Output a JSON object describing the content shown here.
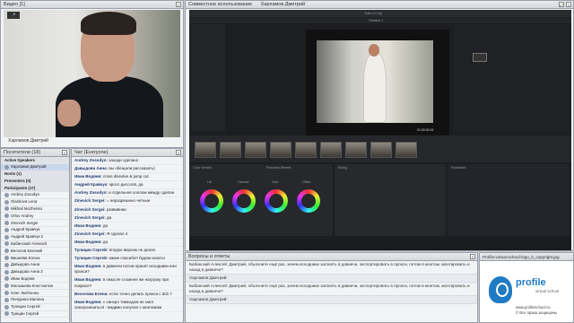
{
  "video": {
    "title": "Видео",
    "count": "[1]",
    "presenter": "Харламов Дмитрий"
  },
  "share": {
    "title": "Совместное использование",
    "presenter_tab": "Харламов Дмитрий",
    "app": {
      "page_title": "Timeline 1",
      "clip_name": "Kate 01 Clip",
      "timecode": "01:00:00:01",
      "panels": [
        "Color Wheels",
        "Primaries Wheels",
        "Sizing",
        "Keyframes"
      ],
      "wheels": [
        "Lift",
        "Gamma",
        "Gain",
        "Offset"
      ]
    }
  },
  "participants": {
    "title": "Посетители",
    "count": "(18)",
    "rows": [
      {
        "label": "Active Speakers",
        "type": "group"
      },
      {
        "label": "Харламов Дмитрий",
        "type": "sel"
      },
      {
        "label": "Hosts (1)",
        "type": "group"
      },
      {
        "label": "Presenters (0)",
        "type": "group"
      },
      {
        "label": "Participants (17)",
        "type": "group"
      },
      {
        "label": "Andrey Zosodyn",
        "type": "p"
      },
      {
        "label": "Glazkova Lena",
        "type": "p"
      },
      {
        "label": "Mikhail Mozhenko",
        "type": "p"
      },
      {
        "label": "Orlov Andrey",
        "type": "p"
      },
      {
        "label": "Zinevich Sergei",
        "type": "p"
      },
      {
        "label": "Андрей Кравчук",
        "type": "p"
      },
      {
        "label": "Андрей Кравчук 2",
        "type": "p"
      },
      {
        "label": "Бабинский Алексей",
        "type": "p"
      },
      {
        "label": "Веселов Евгений",
        "type": "p"
      },
      {
        "label": "Вишнёва Елена",
        "type": "p"
      },
      {
        "label": "Давыдова Анна",
        "type": "p"
      },
      {
        "label": "Давыдова Анна 2",
        "type": "p"
      },
      {
        "label": "Иван Водяев",
        "type": "p"
      },
      {
        "label": "Малышева Константин",
        "type": "p"
      },
      {
        "label": "Олег Любченко",
        "type": "p"
      },
      {
        "label": "Пичурина Милена",
        "type": "p"
      },
      {
        "label": "Тулицин Сергей",
        "type": "p"
      },
      {
        "label": "Туищин Сергей",
        "type": "p"
      }
    ]
  },
  "chat": {
    "title": "Чат",
    "sub": "(Everyone)",
    "messages": [
      {
        "from": "Andrey Zosodyn:",
        "text": "заходи сделано"
      },
      {
        "from": "Давыдова Анна:",
        "text": "вы обещали рассказать)"
      },
      {
        "from": "Иван Водяев:",
        "text": "cross dissolve & jump cut"
      },
      {
        "from": "Андрей Кравчук:",
        "text": "кросс-диссолв, да"
      },
      {
        "from": "Andrey Zosodyn:",
        "text": "и отдельное хоплом между сделан"
      },
      {
        "from": "Zinevich Sergei:",
        "text": "= неразрешено четные"
      },
      {
        "from": "Zinevich Sergei:",
        "text": "развивнан"
      },
      {
        "from": "Zinevich Sergei:",
        "text": "да"
      },
      {
        "from": "Иван Водяев:",
        "text": "да"
      },
      {
        "from": "Zinevich Sergei:",
        "text": "Я сделал 4"
      },
      {
        "from": "Иван Водяев:",
        "text": "да"
      },
      {
        "from": "Тулицин Сергей:",
        "text": "вторую версию не делал"
      },
      {
        "from": "Тулицин Сергей:",
        "text": "какие спасибо!! будем искать!"
      },
      {
        "from": "Иван Водяев:",
        "text": "в давинчи потом хранят исходники или прокси?"
      },
      {
        "from": "Иван Водяев:",
        "text": "в смысле сложнее же нагрузку при покрасе?"
      },
      {
        "from": "Веселова Елена:",
        "text": "если точно делать прокси с dcb ?"
      },
      {
        "from": "Иван Водяев:",
        "text": "с синхро тимкодом не смог синхронизиться - видимо получал с монтажом"
      }
    ]
  },
  "qa": {
    "title": "Вопросы и ответы",
    "items": [
      "Бабинский Алексей: Дмитрий, объясните ещё раз, зачем исходники загонять в давинчи, экспортировать в прокси, потом в монтаж, монтировать и назад в давинчи?",
      "Харламов Дмитрий:",
      "Бабинский Алексей: Дмитрий, объясните ещё раз, зачем исходники загонять в давинчи, экспортировать в прокси, потом в монтаж, монтировать и назад в давинчи?",
      "Харламов Дмитрий:"
    ]
  },
  "file": {
    "title": "Profile-virtual-school-logo_h_copyright.jpg",
    "brand": "profile",
    "brand_sub": "virtual school",
    "site": "www.profileschool.ru",
    "copyright": "© Все права защищены"
  }
}
